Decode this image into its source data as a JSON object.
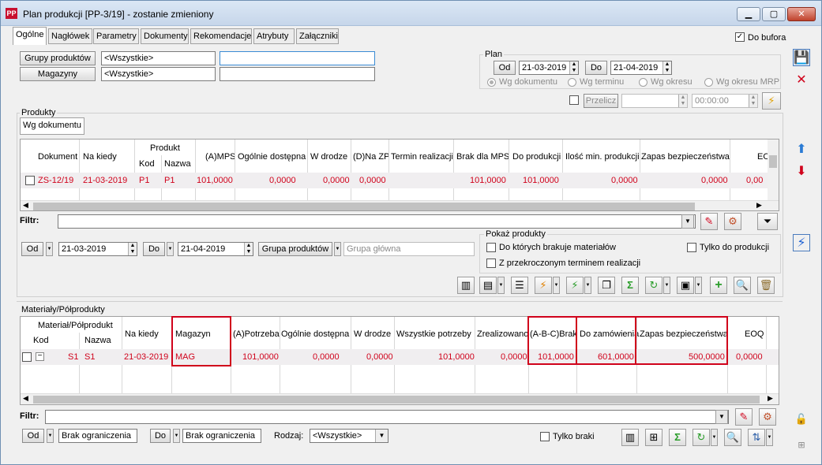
{
  "window": {
    "title": "Plan produkcji [PP-3/19] - zostanie zmieniony",
    "app_icon": "PP"
  },
  "tabs": [
    "Ogólne",
    "Nagłówek",
    "Parametry",
    "Dokumenty",
    "Rekomendacje",
    "Atrybuty",
    "Załączniki"
  ],
  "do_bufora": {
    "label": "Do bufora",
    "checked": true
  },
  "filters": {
    "grupy_produktow_btn": "Grupy produktów",
    "grupy_value": "<Wszystkie>",
    "magazyny_btn": "Magazyny",
    "magazyny_value": "<Wszystkie>"
  },
  "plan": {
    "title": "Plan",
    "od_label": "Od",
    "od_value": "21-03-2019",
    "do_label": "Do",
    "do_value": "21-04-2019",
    "radio_dokument": "Wg dokumentu",
    "radio_termin": "Wg terminu",
    "radio_okres": "Wg okresu",
    "radio_okres_mrp": "Wg okresu MRP",
    "przelicz": "Przelicz",
    "time": "00:00:00"
  },
  "produkty": {
    "section_title": "Produkty",
    "view_tab": "Wg dokumentu",
    "columns": {
      "dokument": "Dokument",
      "na_kiedy": "Na kiedy",
      "produkt": "Produkt",
      "kod": "Kod",
      "nazwa": "Nazwa",
      "mps": "(A)MPS",
      "ogolnie": "Ogólnie dostępna",
      "w_drodze": "W drodze",
      "na_zp": "(D)Na ZP",
      "termin": "Termin realizacji",
      "brak_mps": "Brak dla MPS",
      "do_produkcji": "Do produkcji",
      "ilosc_min": "Ilość min. produkcji",
      "zapas": "Zapas bezpieczeństwa",
      "eoq": "EO"
    },
    "rows": [
      {
        "dokument": "ZS-12/19",
        "na_kiedy": "21-03-2019",
        "kod": "P1",
        "nazwa": "P1",
        "mps": "101,0000",
        "ogolnie": "0,0000",
        "w_drodze": "0,0000",
        "na_zp": "0,0000",
        "brak_mps": "101,0000",
        "do_produkcji": "101,0000",
        "ilosc_min": "0,0000",
        "zapas": "0,0000",
        "eoq": "0,00"
      }
    ],
    "filtr_label": "Filtr:",
    "od_label": "Od",
    "od_value": "21-03-2019",
    "do_label": "Do",
    "do_value": "21-04-2019",
    "grupa_btn": "Grupa produktów",
    "grupa_value": "Grupa główna",
    "pokaz": {
      "title": "Pokaż produkty",
      "opt1": "Do których brakuje materiałów",
      "opt2": "Z przekroczonym terminem realizacji",
      "opt3": "Tylko do produkcji"
    }
  },
  "materialy": {
    "section_title": "Materiały/Półprodukty",
    "columns": {
      "material": "Materiał/Półprodukt",
      "kod": "Kod",
      "nazwa": "Nazwa",
      "na_kiedy": "Na kiedy",
      "magazyn": "Magazyn",
      "potrzeba": "(A)Potrzeba",
      "ogolnie": "Ogólnie dostępna",
      "w_drodze": "W drodze",
      "wszystkie": "Wszystkie potrzeby",
      "zrealizowano": "Zrealizowano",
      "brak": "(A-B-C)Brak",
      "do_zamowienia": "Do zamówienia",
      "zapas": "Zapas bezpieczeństwa",
      "eoq": "EOQ"
    },
    "rows": [
      {
        "kod": "S1",
        "nazwa": "S1",
        "na_kiedy": "21-03-2019",
        "magazyn": "MAG",
        "potrzeba": "101,0000",
        "ogolnie": "0,0000",
        "w_drodze": "0,0000",
        "wszystkie": "101,0000",
        "zrealizowano": "0,0000",
        "brak": "101,0000",
        "do_zamowienia": "601,0000",
        "zapas": "500,0000",
        "eoq": "0,0000"
      }
    ],
    "filtr_label": "Filtr:",
    "od_label": "Od",
    "od_value": "Brak ograniczenia",
    "do_label": "Do",
    "do_value": "Brak ograniczenia",
    "rodzaj_label": "Rodzaj:",
    "rodzaj_value": "<Wszystkie>",
    "tylko_braki": "Tylko braki"
  },
  "colors": {
    "accent": "#d0021b",
    "highlight_box": "#d0021b",
    "link_blue": "#3a8bd4"
  }
}
